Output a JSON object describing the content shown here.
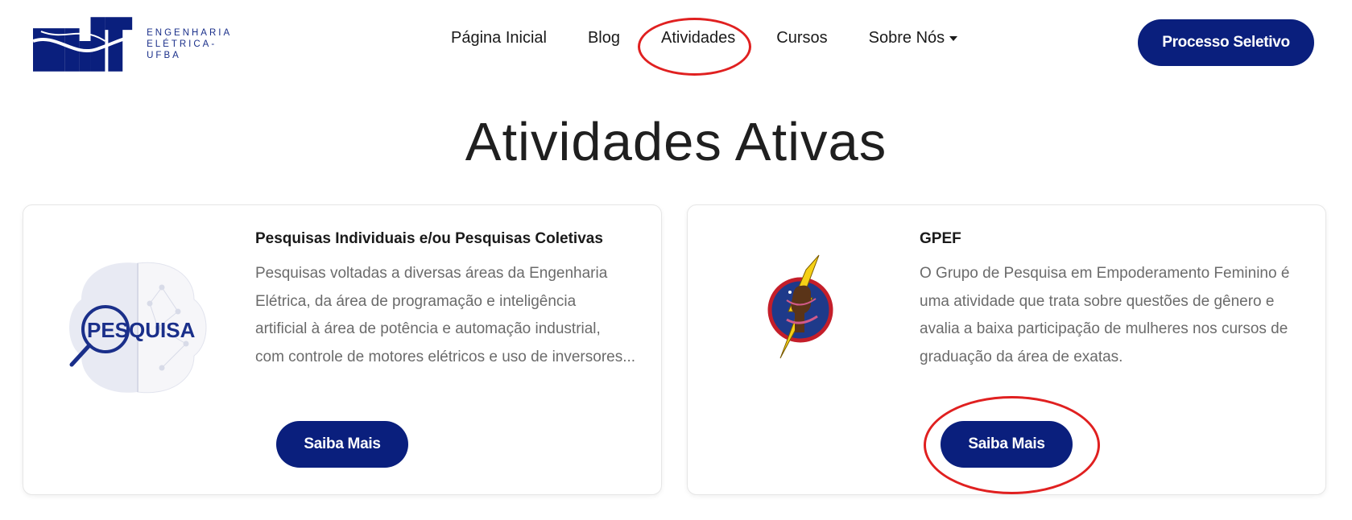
{
  "header": {
    "logo_text": [
      "ENGENHARIA",
      "ELÉTRICA-UFBA"
    ],
    "nav": [
      {
        "label": "Página Inicial"
      },
      {
        "label": "Blog"
      },
      {
        "label": "Atividades"
      },
      {
        "label": "Cursos"
      },
      {
        "label": "Sobre Nós",
        "has_dropdown": true
      }
    ],
    "cta_label": "Processo Seletivo"
  },
  "page": {
    "title": "Atividades Ativas"
  },
  "cards": [
    {
      "title": "Pesquisas Individuais e/ou Pesquisas Coletivas",
      "image_text": "PESQUISA",
      "description_lines": [
        "Pesquisas voltadas a diversas áreas da Engenharia",
        "Elétrica, da área de programação e inteligência",
        "artificial à área de potência e automação industrial,",
        "com controle de motores elétricos e uso de inversores..."
      ],
      "button_label": "Saiba Mais"
    },
    {
      "title": "GPEF",
      "description_lines": [
        "O Grupo de Pesquisa em Empoderamento Feminino é",
        "uma atividade que trata sobre questões de gênero e",
        "avalia a baixa participação de mulheres nos cursos de",
        "graduação da área de exatas."
      ],
      "button_label": "Saiba Mais"
    }
  ],
  "colors": {
    "brand": "#0a1f7d",
    "highlight": "#e02020",
    "text_muted": "#6b6b6b"
  },
  "icons": {
    "logo": "pet-eletrica-logo",
    "caret": "caret-down-icon",
    "research_image": "pesquisa-brain-magnifier",
    "gpef_image": "gpef-fist-lightning"
  }
}
